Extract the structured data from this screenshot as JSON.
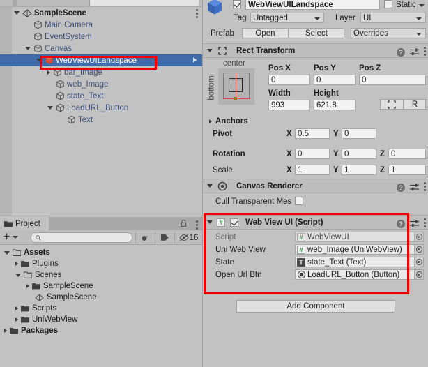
{
  "hierarchy": {
    "rows": [
      {
        "label": "SampleScene",
        "indent": 0,
        "type": "scene",
        "arrow": "open",
        "selected": false,
        "kebab": true
      },
      {
        "label": "Main Camera",
        "indent": 1,
        "type": "go",
        "arrow": "none",
        "selected": false
      },
      {
        "label": "EventSystem",
        "indent": 1,
        "type": "go",
        "arrow": "none",
        "selected": false
      },
      {
        "label": "Canvas",
        "indent": 1,
        "type": "go",
        "arrow": "open",
        "selected": false
      },
      {
        "label": "WebViewUILandspace",
        "indent": 2,
        "type": "prefab",
        "arrow": "open",
        "selected": true
      },
      {
        "label": "bar_Image",
        "indent": 3,
        "type": "go",
        "arrow": "closed",
        "selected": false
      },
      {
        "label": "web_Image",
        "indent": 3,
        "type": "go",
        "arrow": "none",
        "selected": false
      },
      {
        "label": "state_Text",
        "indent": 3,
        "type": "go",
        "arrow": "none",
        "selected": false
      },
      {
        "label": "LoadURL_Button",
        "indent": 3,
        "type": "go",
        "arrow": "open",
        "selected": false
      },
      {
        "label": "Text",
        "indent": 4,
        "type": "go",
        "arrow": "none",
        "selected": false
      }
    ]
  },
  "project": {
    "tab_label": "Project",
    "search_placeholder": "",
    "badge_count": "16",
    "rows": [
      {
        "label": "Assets",
        "indent": 0,
        "arrow": "open",
        "icon": "folder-open",
        "bold": true
      },
      {
        "label": "Plugins",
        "indent": 1,
        "arrow": "closed",
        "icon": "folder",
        "bold": false
      },
      {
        "label": "Scenes",
        "indent": 1,
        "arrow": "open",
        "icon": "folder-open",
        "bold": false
      },
      {
        "label": "SampleScene",
        "indent": 2,
        "arrow": "closed",
        "icon": "folder",
        "bold": false
      },
      {
        "label": "SampleScene",
        "indent": 2,
        "arrow": "none",
        "icon": "scene",
        "bold": false
      },
      {
        "label": "Scripts",
        "indent": 1,
        "arrow": "closed",
        "icon": "folder",
        "bold": false
      },
      {
        "label": "UniWebView",
        "indent": 1,
        "arrow": "closed",
        "icon": "folder",
        "bold": false
      },
      {
        "label": "Packages",
        "indent": 0,
        "arrow": "closed",
        "icon": "folder",
        "bold": true
      }
    ]
  },
  "inspector": {
    "object_name": "WebViewUILandspace",
    "enabled": true,
    "static_label": "Static",
    "static_checked": false,
    "tag_label": "Tag",
    "tag_value": "Untagged",
    "layer_label": "Layer",
    "layer_value": "UI",
    "prefab_label": "Prefab",
    "prefab_open": "Open",
    "prefab_select": "Select",
    "prefab_overrides": "Overrides",
    "rect_transform": {
      "title": "Rect Transform",
      "anchor_top_label": "center",
      "anchor_side_label": "bottom",
      "pos_x_label": "Pos X",
      "pos_y_label": "Pos Y",
      "pos_z_label": "Pos Z",
      "pos_x": "0",
      "pos_y": "0",
      "pos_z": "0",
      "width_label": "Width",
      "height_label": "Height",
      "width": "993",
      "height": "621.8",
      "raw_button": "R",
      "anchors_label": "Anchors",
      "pivot_label": "Pivot",
      "pivot_x": "0.5",
      "pivot_y": "0",
      "rotation_label": "Rotation",
      "rot_x": "0",
      "rot_y": "0",
      "rot_z": "0",
      "scale_label": "Scale",
      "scale_x": "1",
      "scale_y": "1",
      "scale_z": "1",
      "axis_x": "X",
      "axis_y": "Y",
      "axis_z": "Z"
    },
    "canvas_renderer": {
      "title": "Canvas Renderer",
      "cull_label": "Cull Transparent Mes",
      "cull_checked": false
    },
    "web_view_ui": {
      "title": "Web View UI (Script)",
      "enabled": true,
      "fields": [
        {
          "label": "Script",
          "value": "WebViewUI",
          "icon": "script-hash",
          "dim": true
        },
        {
          "label": "Uni Web View",
          "value": "web_Image (UniWebView)",
          "icon": "script-hash",
          "dim": false
        },
        {
          "label": "State",
          "value": "state_Text (Text)",
          "icon": "text-t",
          "dim": false
        },
        {
          "label": "Open Url Btn",
          "value": "LoadURL_Button (Button)",
          "icon": "button-dot",
          "dim": false
        }
      ]
    },
    "add_component": "Add Component"
  },
  "colors": {
    "panel_bg": "#c2c2c2",
    "selection_blue": "#3f6ba8",
    "annotation_red": "#ee0000",
    "header_gray": "#bdbdbd",
    "field_bg": "#f2f2f2",
    "link_blue": "#3c4e7a"
  }
}
